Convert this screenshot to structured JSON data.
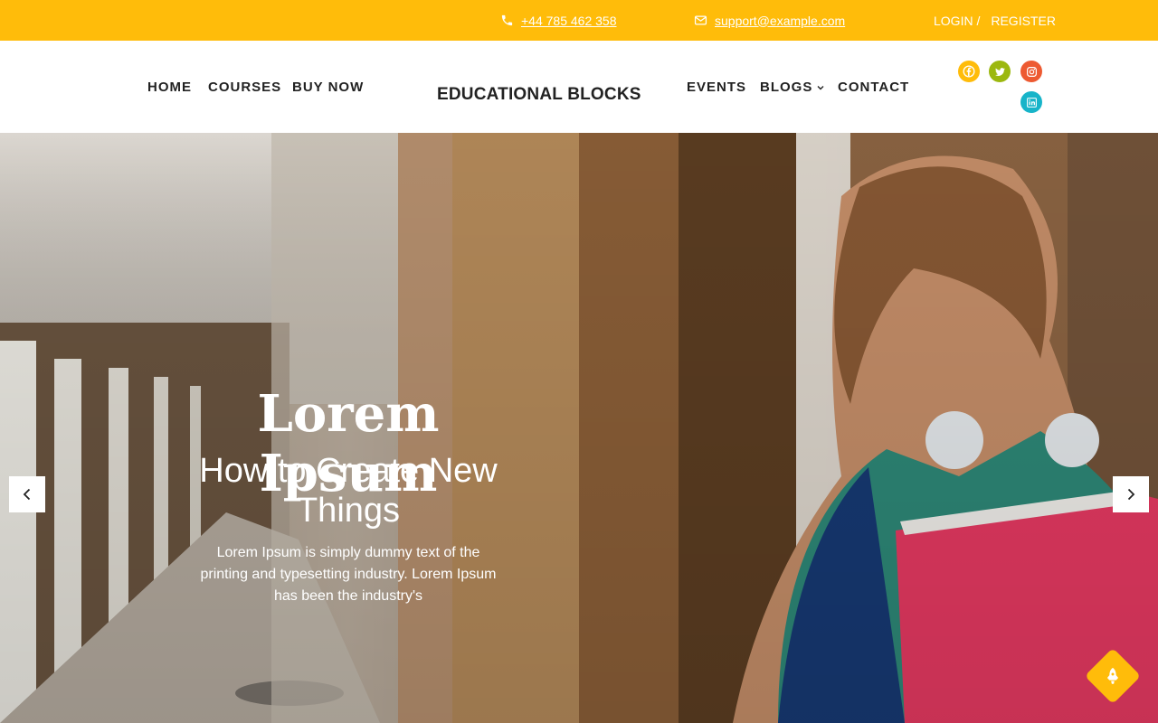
{
  "topbar": {
    "phone": "+44 785 462 358",
    "email": "support@example.com",
    "login": "LOGIN /",
    "register": "REGISTER",
    "background": "#ffbc0a"
  },
  "header": {
    "logo": "EDUCATIONAL BLOCKS",
    "nav_left": [
      "HOME",
      "COURSES",
      "BUY NOW"
    ],
    "nav_right": [
      "EVENTS",
      "BLOGS",
      "CONTACT"
    ],
    "social": [
      {
        "icon": "facebook-icon",
        "color": "#ffbc0a"
      },
      {
        "icon": "twitter-icon",
        "color": "#9cb80f"
      },
      {
        "icon": "instagram-icon",
        "color": "#ed5a32"
      },
      {
        "icon": "linkedin-icon",
        "color": "#17b4c9"
      }
    ]
  },
  "hero": {
    "title": "Lorem Ipsum",
    "subtitle": "How to Create New Things",
    "text": "Lorem Ipsum is simply dummy text of the printing and typesetting industry. Lorem Ipsum has been the industry's",
    "prev_icon": "chevron-left-icon",
    "next_icon": "chevron-right-icon"
  },
  "scroll_top": {
    "icon": "rocket-icon",
    "color": "#ffbc0a"
  }
}
